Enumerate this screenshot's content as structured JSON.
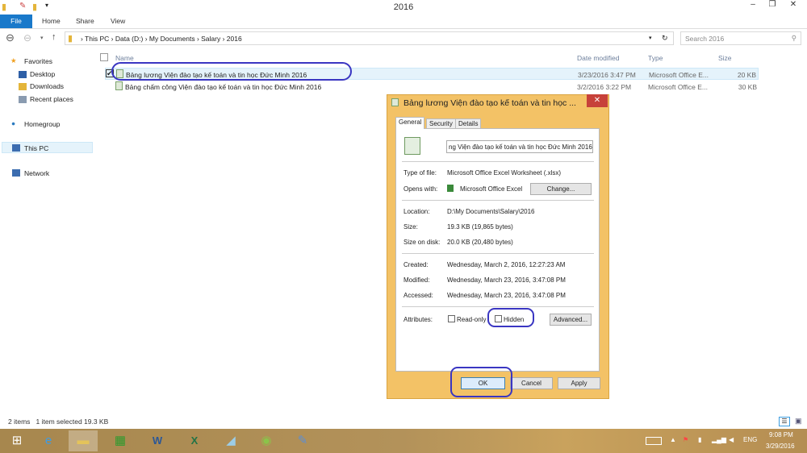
{
  "window": {
    "title": "2016",
    "min": "‒",
    "max": "❐",
    "close": "✕"
  },
  "ribbon": {
    "tabs": [
      "File",
      "Home",
      "Share",
      "View"
    ]
  },
  "address": {
    "crumbs": [
      "This PC",
      "Data (D:)",
      "My Documents",
      "Salary",
      "2016"
    ],
    "search_placeholder": "Search 2016"
  },
  "nav": {
    "favorites": "Favorites",
    "desktop": "Desktop",
    "downloads": "Downloads",
    "recent": "Recent places",
    "homegroup": "Homegroup",
    "thispc": "This PC",
    "network": "Network"
  },
  "columns": {
    "name": "Name",
    "date": "Date modified",
    "type": "Type",
    "size": "Size"
  },
  "files": [
    {
      "name": "Bảng lương Viện đào tạo kế toán và tin học Đức Minh 2016",
      "date": "3/23/2016 3:47 PM",
      "type": "Microsoft Office E...",
      "size": "20 KB",
      "selected": true
    },
    {
      "name": "Bảng chấm công Viện đào tạo kế toán và tin học Đức Minh 2016",
      "date": "3/2/2016 3:22 PM",
      "type": "Microsoft Office E...",
      "size": "30 KB",
      "selected": false
    }
  ],
  "dialog": {
    "title": "Bảng lương Viện đào tạo kế toán và tin học ...",
    "tabs": [
      "General",
      "Security",
      "Details"
    ],
    "filename": "ng Viện đào tạo kế toán và tin học Đức Minh 2016",
    "type_label": "Type of file:",
    "type_value": "Microsoft Office Excel Worksheet (.xlsx)",
    "opens_label": "Opens with:",
    "opens_value": "Microsoft Office Excel",
    "change": "Change...",
    "location_label": "Location:",
    "location_value": "D:\\My Documents\\Salary\\2016",
    "size_label": "Size:",
    "size_value": "19.3 KB (19,865 bytes)",
    "disk_label": "Size on disk:",
    "disk_value": "20.0 KB (20,480 bytes)",
    "created_label": "Created:",
    "created_value": "Wednesday, March 2, 2016, 12:27:23 AM",
    "modified_label": "Modified:",
    "modified_value": "Wednesday, March 23, 2016, 3:47:08 PM",
    "accessed_label": "Accessed:",
    "accessed_value": "Wednesday, March 23, 2016, 3:47:08 PM",
    "attr_label": "Attributes:",
    "readonly": "Read-only",
    "hidden": "Hidden",
    "advanced": "Advanced...",
    "ok": "OK",
    "cancel": "Cancel",
    "apply": "Apply"
  },
  "status": {
    "items": "2 items",
    "selected": "1 item selected  19.3 KB"
  },
  "tray": {
    "lang": "ENG",
    "time": "9:08 PM",
    "date": "3/29/2016"
  }
}
